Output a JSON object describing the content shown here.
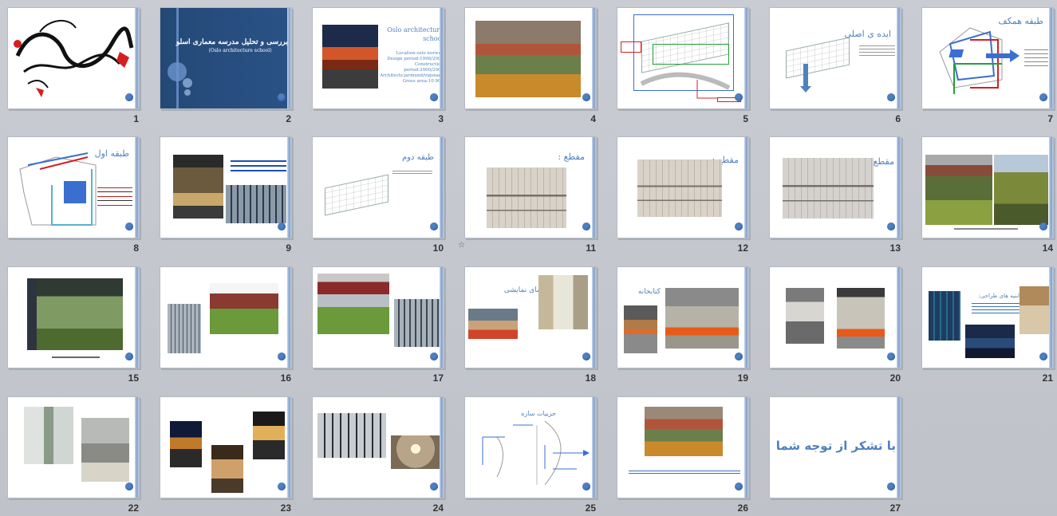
{
  "slides": [
    {
      "num": "1",
      "title": "",
      "texts": []
    },
    {
      "num": "2",
      "title": "بررسی و تحلیل مدرسه معماری اسلو",
      "subtitle": "(Oslo architecture school)",
      "texts": []
    },
    {
      "num": "3",
      "title": "Oslo architecture school",
      "texts": [
        "Location:oslo norway",
        "Design period:1998/2000",
        "Construction period:2000/2001",
        "Architects:jarmund/vigsnaes",
        "Gross area:10.900"
      ]
    },
    {
      "num": "4",
      "title": "",
      "texts": []
    },
    {
      "num": "5",
      "title": "",
      "texts": []
    },
    {
      "num": "6",
      "title": "ایده ی اصلی",
      "texts": []
    },
    {
      "num": "7",
      "title": "طبقه همکف",
      "texts": []
    },
    {
      "num": "8",
      "title": "طبقه اول",
      "texts": []
    },
    {
      "num": "9",
      "title": "",
      "texts": []
    },
    {
      "num": "10",
      "title": "طبقه دوم",
      "texts": []
    },
    {
      "num": "11",
      "title": "مقطع :",
      "texts": []
    },
    {
      "num": "12",
      "title": "مقطع :",
      "texts": []
    },
    {
      "num": "13",
      "title": "مقطع :",
      "texts": []
    },
    {
      "num": "14",
      "title": "",
      "texts": []
    },
    {
      "num": "15",
      "title": "",
      "texts": []
    },
    {
      "num": "16",
      "title": "",
      "texts": []
    },
    {
      "num": "17",
      "title": "",
      "texts": []
    },
    {
      "num": "18",
      "title": "فضای نمایشی",
      "texts": []
    },
    {
      "num": "19",
      "title": "کتابخانه",
      "texts": []
    },
    {
      "num": "20",
      "title": "",
      "texts": []
    },
    {
      "num": "21",
      "title": "ابنیه های طراحی:",
      "texts": []
    },
    {
      "num": "22",
      "title": "",
      "texts": []
    },
    {
      "num": "23",
      "title": "",
      "texts": []
    },
    {
      "num": "24",
      "title": "",
      "texts": []
    },
    {
      "num": "25",
      "title": "جزییات سازه",
      "texts": []
    },
    {
      "num": "26",
      "title": "",
      "texts": []
    },
    {
      "num": "27",
      "title": "با تشکر از توجه شما",
      "texts": []
    }
  ],
  "icons": {
    "slide_transition": "star-icon"
  },
  "colors": {
    "accent": "#4f81bd",
    "dark_blue": "#2a4f80",
    "red": "#d42020",
    "background": "#c5c9cf"
  }
}
